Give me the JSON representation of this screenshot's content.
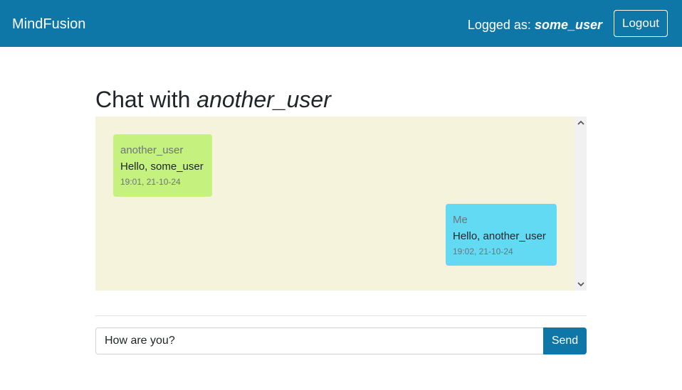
{
  "navbar": {
    "brand": "MindFusion",
    "logged_as_label": "Logged as:",
    "username": "some_user",
    "logout_label": "Logout",
    "background_color": "#0f76a8"
  },
  "chat": {
    "title_prefix": "Chat with",
    "partner": "another_user",
    "background_color": "#f5f3dc",
    "messages": [
      {
        "sender": "another_user",
        "text": "Hello, some_user",
        "time": "19:01, 21-10-24",
        "direction": "incoming",
        "color": "#c5f17f"
      },
      {
        "sender": "Me",
        "text": "Hello, another_user",
        "time": "19:02, 21-10-24",
        "direction": "outgoing",
        "color": "#63daf3"
      }
    ]
  },
  "composer": {
    "input_value": "How are you?",
    "send_label": "Send"
  },
  "icons": {
    "scroll_up": "chevron-up-icon",
    "scroll_down": "chevron-down-icon"
  }
}
